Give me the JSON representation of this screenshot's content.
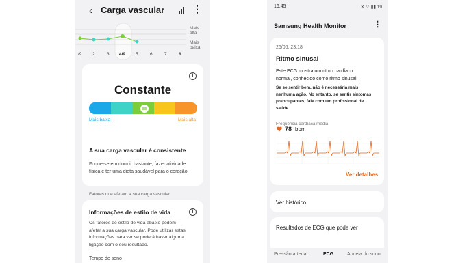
{
  "left": {
    "title": "Carga vascular",
    "trend": {
      "high_label": [
        "Mais",
        "alta"
      ],
      "low_label": [
        "Mais",
        "baixa"
      ],
      "days": [
        "/9",
        "2",
        "3",
        "4/9",
        "5",
        "6",
        "7",
        "8"
      ]
    },
    "status": {
      "value": "Constante",
      "scale_colors": [
        "#1aa8e8",
        "#3fd3c8",
        "#7ccc3c",
        "#f8c51c",
        "#f7952b"
      ],
      "scale_low": "Mais baixa",
      "scale_high": "Mais alta",
      "scale_low_color": "#1aa8e8",
      "scale_high_color": "#f7952b",
      "heading": "A sua carga vascular é consistente",
      "body": [
        "Foque-se em dormir bastante, fazer atividade",
        "física e ter uma dieta saudável para o coração."
      ]
    },
    "factors_label": "Fatores que afetam a sua carga vascular",
    "lifestyle": {
      "heading": "Informações de estilo de vida",
      "body": [
        "Os fatores de estilo de vida abaixo podem",
        "afetar a sua carga vascular. Pode utilizar estas",
        "informações para ver se poderá haver alguma",
        "ligação com o seu resultado."
      ],
      "sleep_label": "Tempo de sono"
    }
  },
  "right": {
    "status_time": "16:45",
    "status_right": "✕ ⌔ ▮▮ 19",
    "app_title": "Samsung Health Monitor",
    "ecg": {
      "date": "26/06, 23:18",
      "heading": "Ritmo sinusal",
      "body": [
        "Este ECG mostra um ritmo cardíaco",
        "normal, conhecido como ritmo sinusal."
      ],
      "bold_body": [
        "Se se sentir bem, não é necessária mais",
        "nenhuma ação. No entanto, se sentir sintomas",
        "preocupantes, fale com um profissional de",
        "saúde."
      ],
      "hr_label": "Frequência cardíaca média",
      "hr_value": "78",
      "hr_unit": "bpm",
      "details_link": "Ver detalhes"
    },
    "history": "Ver histórico",
    "results": "Resultados de ECG que pode ver",
    "tabs": [
      "Pressão arterial",
      "ECG",
      "Apneia do sono"
    ]
  }
}
